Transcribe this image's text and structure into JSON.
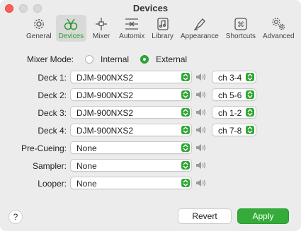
{
  "window": {
    "title": "Devices"
  },
  "toolbar": {
    "items": [
      {
        "label": "General",
        "icon": "gears-icon"
      },
      {
        "label": "Devices",
        "icon": "devices-icon",
        "active": true
      },
      {
        "label": "Mixer",
        "icon": "mixer-icon"
      },
      {
        "label": "Automix",
        "icon": "automix-icon"
      },
      {
        "label": "Library",
        "icon": "library-icon"
      },
      {
        "label": "Appearance",
        "icon": "appearance-icon"
      },
      {
        "label": "Shortcuts",
        "icon": "shortcuts-icon"
      },
      {
        "label": "Advanced",
        "icon": "advanced-icon"
      }
    ]
  },
  "mixer_mode": {
    "label": "Mixer Mode:",
    "options": [
      "Internal",
      "External"
    ],
    "selected": "External"
  },
  "rows": [
    {
      "label": "Deck 1:",
      "device": "DJM-900NXS2",
      "channel": "ch 3-4"
    },
    {
      "label": "Deck 2:",
      "device": "DJM-900NXS2",
      "channel": "ch 5-6"
    },
    {
      "label": "Deck 3:",
      "device": "DJM-900NXS2",
      "channel": "ch 1-2"
    },
    {
      "label": "Deck 4:",
      "device": "DJM-900NXS2",
      "channel": "ch 7-8"
    },
    {
      "label": "Pre-Cueing:",
      "device": "None"
    },
    {
      "label": "Sampler:",
      "device": "None"
    },
    {
      "label": "Looper:",
      "device": "None"
    }
  ],
  "footer": {
    "help": "?",
    "revert": "Revert",
    "apply": "Apply"
  },
  "colors": {
    "accent": "#35ac3a",
    "window_bg": "#ececec",
    "close": "#ff5f57"
  }
}
